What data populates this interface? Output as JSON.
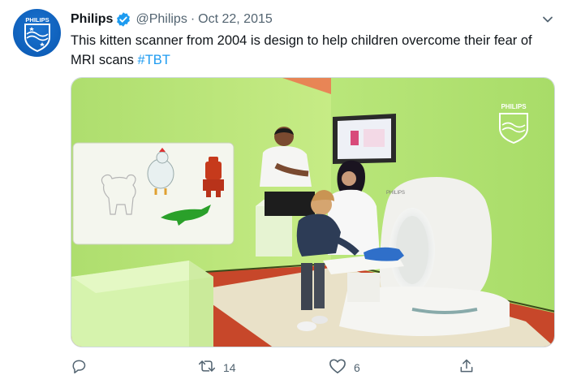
{
  "tweet": {
    "author_name": "Philips",
    "handle": "@Philips",
    "separator": "·",
    "date": "Oct 22, 2015",
    "text_prefix": "This kitten scanner from 2004 is design to help children overcome their fear of MRI scans ",
    "hashtag": "#TBT",
    "avatar_logo_text": "PHILIPS",
    "image_watermark_text": "PHILIPS",
    "machine_label": "PHILIPS"
  },
  "actions": {
    "reply": {
      "icon": "reply-icon",
      "count": ""
    },
    "retweet": {
      "icon": "retweet-icon",
      "count": "14"
    },
    "like": {
      "icon": "heart-icon",
      "count": "6"
    },
    "share": {
      "icon": "share-icon",
      "count": ""
    }
  },
  "colors": {
    "brand_blue": "#0b5ed7",
    "link_blue": "#1d9bf0",
    "secondary_text": "#536471",
    "verified_badge": "#1d9bf0"
  }
}
